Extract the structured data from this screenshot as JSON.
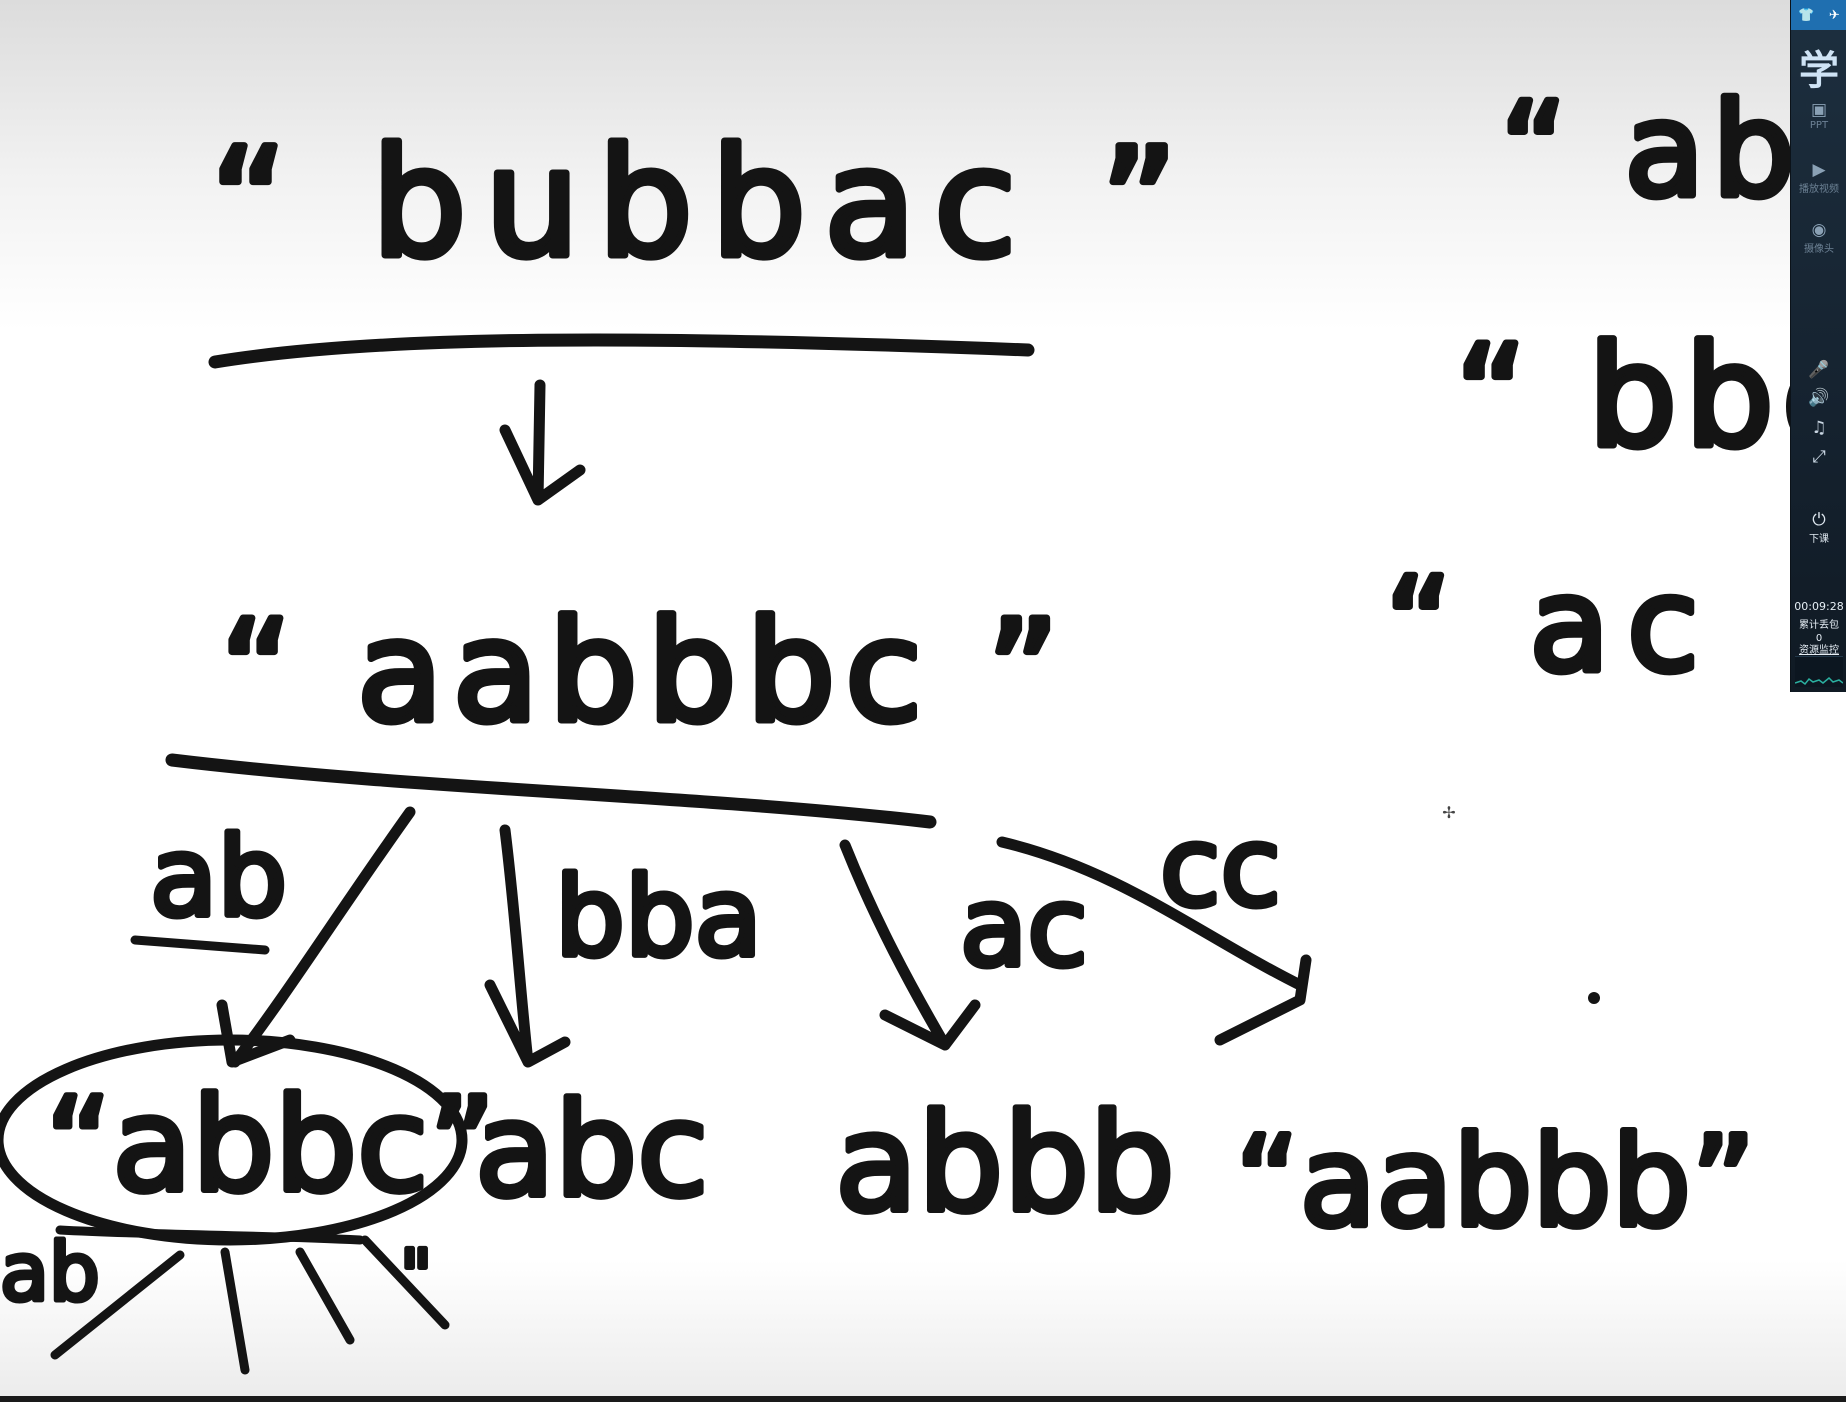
{
  "board": {
    "top_string": "“ bubbac ”",
    "middle_string": "“ aabbbc ”",
    "branch_labels": [
      "ab",
      "bba",
      "ac",
      "cc"
    ],
    "children": [
      "“abbc”",
      "abc",
      "abbb",
      "“aabbb”"
    ],
    "right_column": [
      "“ ab",
      "“ bbc",
      "“ ac"
    ],
    "grandchild_label": "ab"
  },
  "toolbar": {
    "top_icons": [
      "shirt-icon",
      "plane-icon"
    ],
    "logo": "学",
    "items": [
      {
        "icon": "slides-icon",
        "label": "PPT"
      },
      {
        "icon": "play-video-icon",
        "label": "播放视频"
      },
      {
        "icon": "camera-icon",
        "label": "摄像头"
      }
    ],
    "controls": [
      "microphone-icon",
      "speaker-icon",
      "music-icon",
      "fullscreen-icon"
    ],
    "end_class": {
      "icon": "power-icon",
      "label": "下课"
    },
    "timer": "00:09:28",
    "packet_loss_label": "累计丢包",
    "packet_loss_value": "0",
    "resource_monitor": "资源监控",
    "accent": "#1f6fb0"
  }
}
